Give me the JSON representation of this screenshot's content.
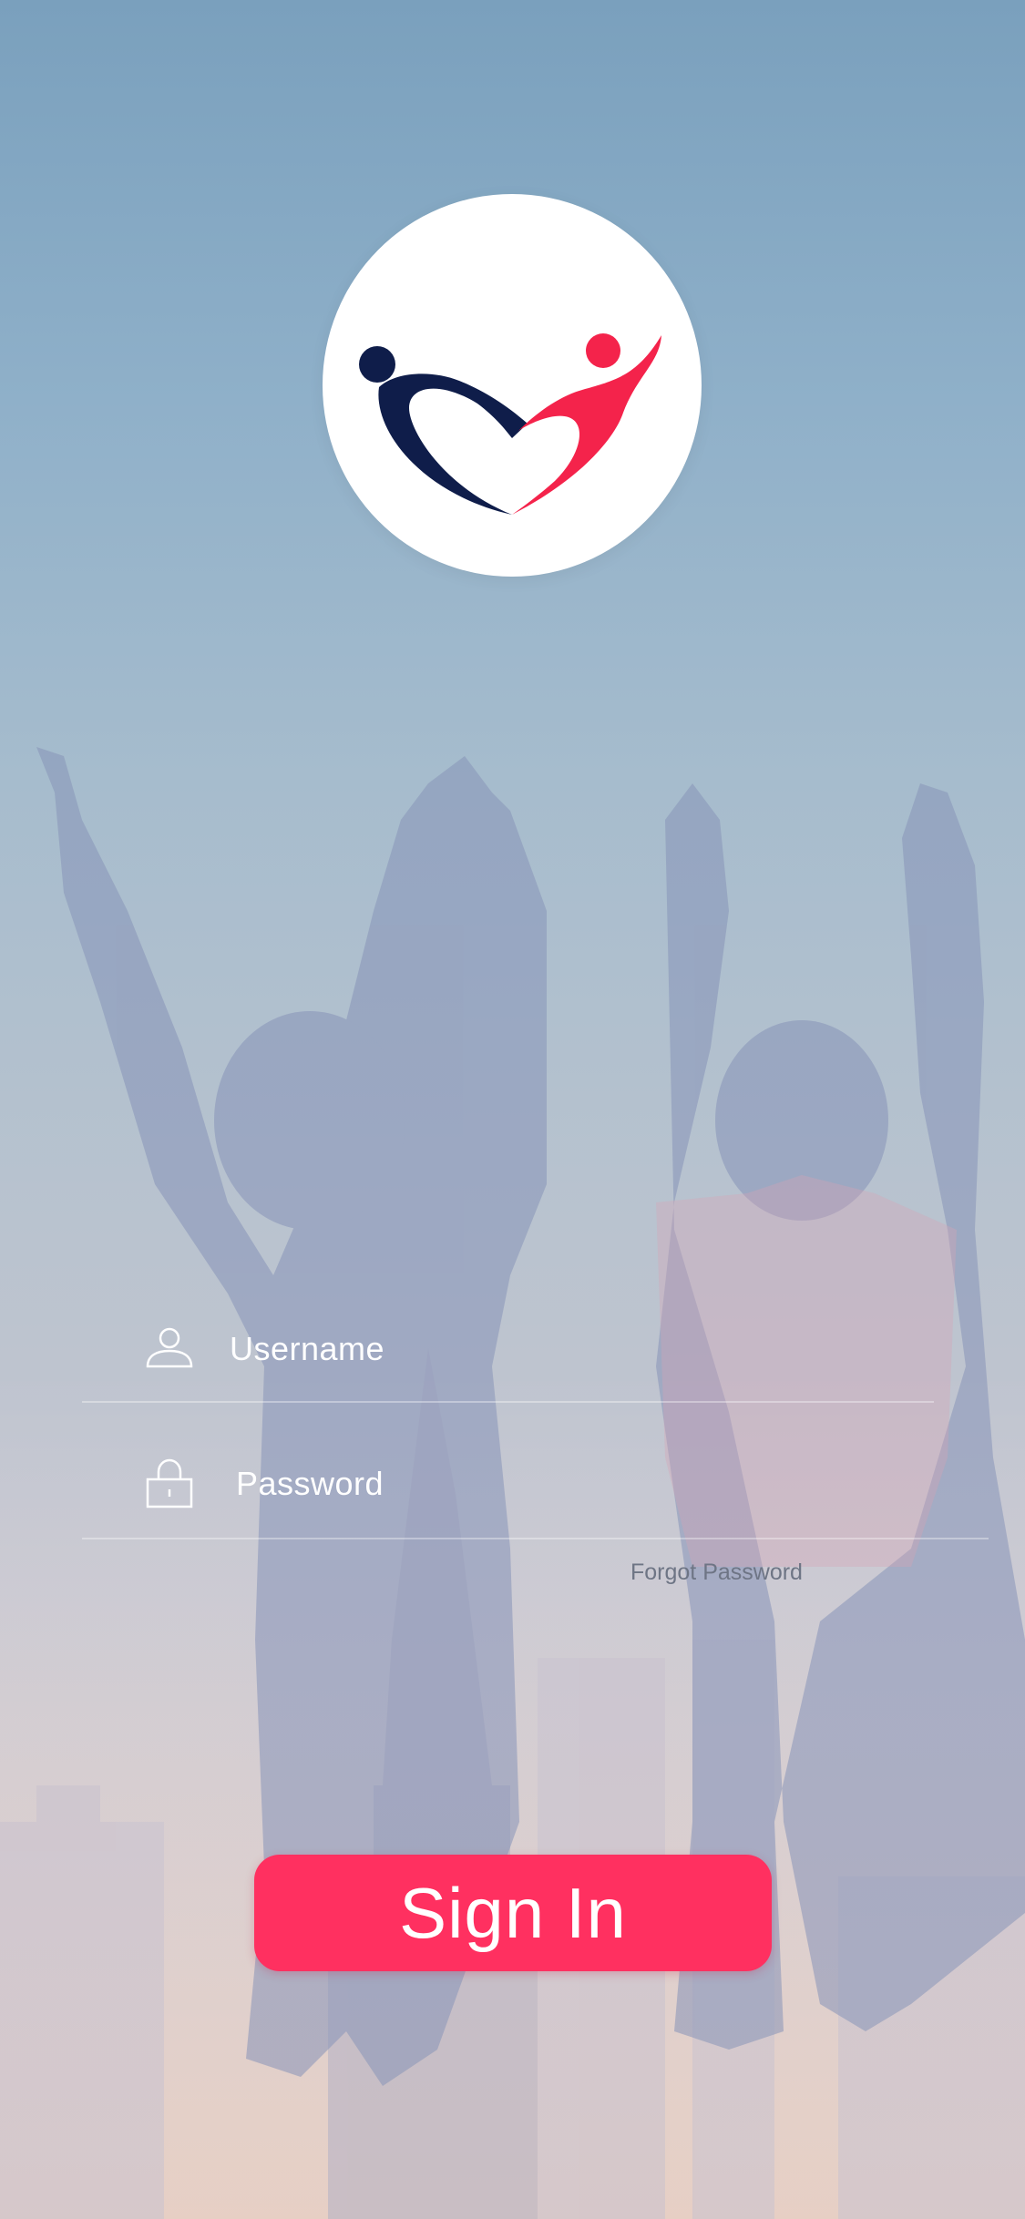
{
  "colors": {
    "accent": "#ff3060",
    "logo_navy": "#0f1d4a",
    "logo_red": "#f4234b",
    "input_text": "#ffffff",
    "link_text": "#6e7585"
  },
  "logo": {
    "icon": "heart-people-icon"
  },
  "form": {
    "username": {
      "icon": "user-icon",
      "placeholder": "Username"
    },
    "password": {
      "icon": "lock-icon",
      "placeholder": "Password"
    },
    "forgot_password": "Forgot Password"
  },
  "signin": {
    "label": "Sign In"
  }
}
